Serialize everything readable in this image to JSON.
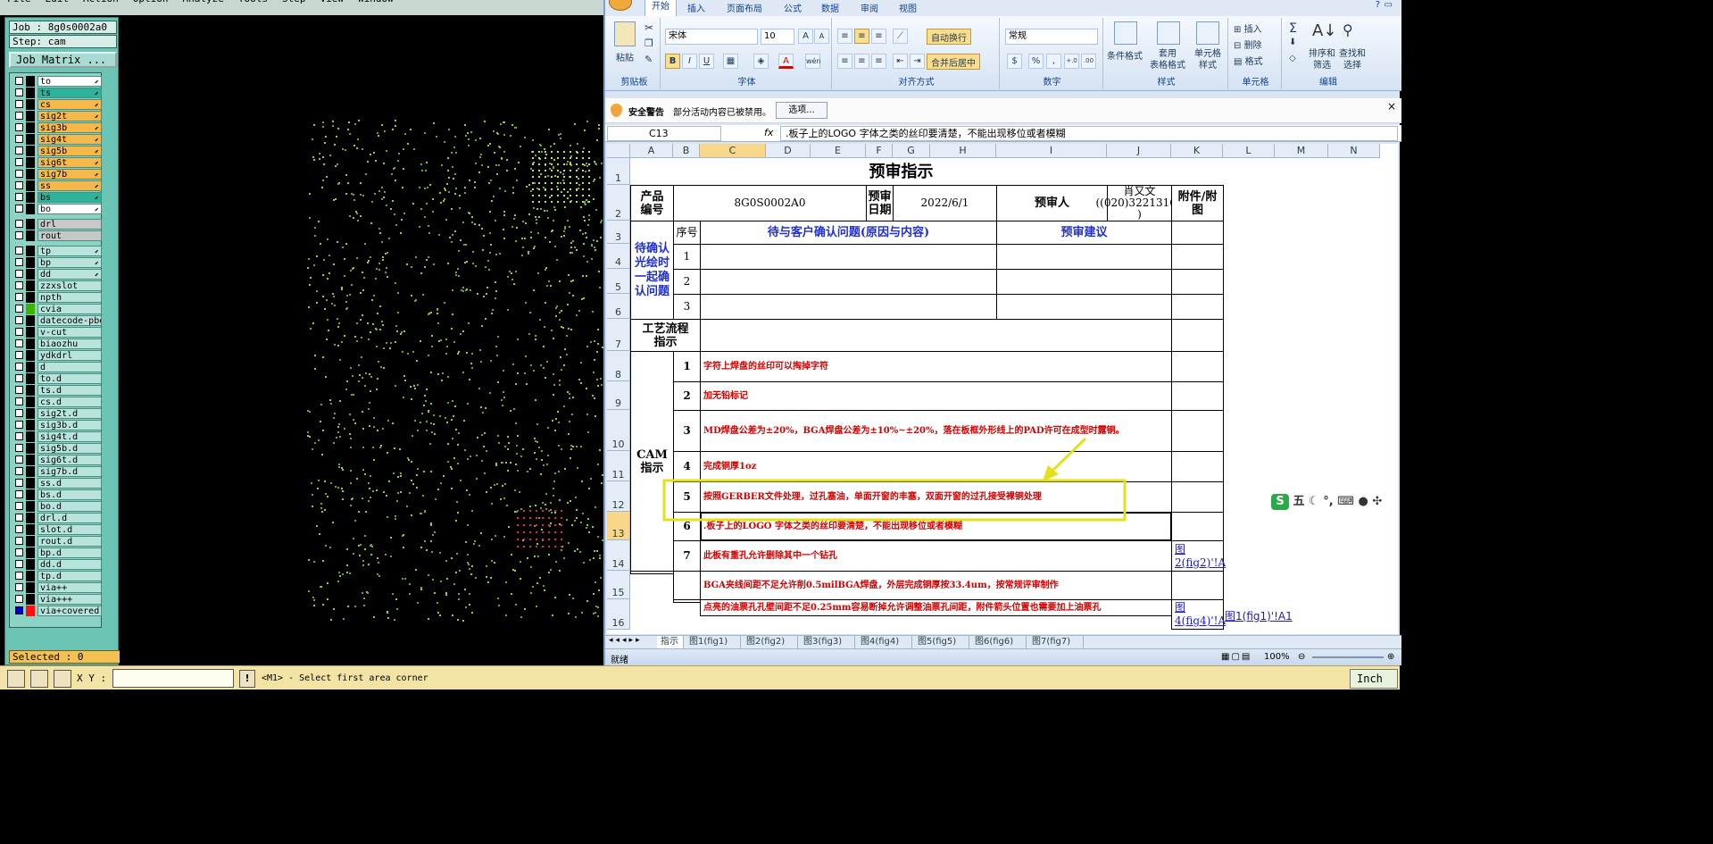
{
  "cam": {
    "menu": [
      "File",
      "Edit",
      "Action",
      "Option",
      "Analyze",
      "Tools",
      "Step",
      "View",
      "Window"
    ],
    "job_label": "Job : 8g0s0002a0",
    "step_label": "Step: cam",
    "job_matrix_button": "Job Matrix ...",
    "layers": [
      {
        "name": "to",
        "color": "#ffffff",
        "arrow": true,
        "checked": false
      },
      {
        "name": "ts",
        "color": "#2db39a",
        "arrow": true,
        "checked": false
      },
      {
        "name": "cs",
        "color": "#f7b84a",
        "arrow": true,
        "checked": false
      },
      {
        "name": "sig2t",
        "color": "#f7b84a",
        "arrow": true,
        "checked": false
      },
      {
        "name": "sig3b",
        "color": "#f7b84a",
        "arrow": true,
        "checked": false
      },
      {
        "name": "sig4t",
        "color": "#f7b84a",
        "arrow": true,
        "checked": false
      },
      {
        "name": "sig5b",
        "color": "#f7b84a",
        "arrow": true,
        "checked": false
      },
      {
        "name": "sig6t",
        "color": "#f7b84a",
        "arrow": true,
        "checked": false
      },
      {
        "name": "sig7b",
        "color": "#f7b84a",
        "arrow": true,
        "checked": false
      },
      {
        "name": "ss",
        "color": "#f7b84a",
        "arrow": true,
        "checked": false
      },
      {
        "name": "bs",
        "color": "#2db39a",
        "arrow": true,
        "checked": false
      },
      {
        "name": "bo",
        "color": "#ffffff",
        "arrow": true,
        "checked": false
      },
      {
        "name": "drl",
        "color": "#c8c8c8",
        "arrow": false,
        "checked": false
      },
      {
        "name": "rout",
        "color": "#c8c8c8",
        "arrow": false,
        "checked": false
      },
      {
        "name": "tp",
        "color": "#b8e4dc",
        "arrow": true,
        "checked": false
      },
      {
        "name": "bp",
        "color": "#b8e4dc",
        "arrow": true,
        "checked": false
      },
      {
        "name": "dd",
        "color": "#b8e4dc",
        "arrow": true,
        "checked": false
      },
      {
        "name": "zzxslot",
        "color": "#b8e4dc",
        "arrow": false,
        "checked": false
      },
      {
        "name": "npth",
        "color": "#b8e4dc",
        "arrow": false,
        "checked": false
      },
      {
        "name": "cvia",
        "color": "#b8e4dc",
        "arrow": false,
        "checked": false
      },
      {
        "name": "datecode-pbe",
        "color": "#b8e4dc",
        "arrow": false,
        "checked": false
      },
      {
        "name": "v-cut",
        "color": "#b8e4dc",
        "arrow": false,
        "checked": false
      },
      {
        "name": "biaozhu",
        "color": "#b8e4dc",
        "arrow": false,
        "checked": false
      },
      {
        "name": "ydkdrl",
        "color": "#b8e4dc",
        "arrow": false,
        "checked": false
      },
      {
        "name": "d",
        "color": "#b8e4dc",
        "arrow": false,
        "checked": false
      },
      {
        "name": "to.d",
        "color": "#b8e4dc",
        "arrow": false,
        "checked": false
      },
      {
        "name": "ts.d",
        "color": "#b8e4dc",
        "arrow": false,
        "checked": false
      },
      {
        "name": "cs.d",
        "color": "#b8e4dc",
        "arrow": false,
        "checked": false
      },
      {
        "name": "sig2t.d",
        "color": "#b8e4dc",
        "arrow": false,
        "checked": false
      },
      {
        "name": "sig3b.d",
        "color": "#b8e4dc",
        "arrow": false,
        "checked": false
      },
      {
        "name": "sig4t.d",
        "color": "#b8e4dc",
        "arrow": false,
        "checked": false
      },
      {
        "name": "sig5b.d",
        "color": "#b8e4dc",
        "arrow": false,
        "checked": false
      },
      {
        "name": "sig6t.d",
        "color": "#b8e4dc",
        "arrow": false,
        "checked": false
      },
      {
        "name": "sig7b.d",
        "color": "#b8e4dc",
        "arrow": false,
        "checked": false
      },
      {
        "name": "ss.d",
        "color": "#b8e4dc",
        "arrow": false,
        "checked": false
      },
      {
        "name": "bs.d",
        "color": "#b8e4dc",
        "arrow": false,
        "checked": false
      },
      {
        "name": "bo.d",
        "color": "#b8e4dc",
        "arrow": false,
        "checked": false
      },
      {
        "name": "drl.d",
        "color": "#b8e4dc",
        "arrow": false,
        "checked": false
      },
      {
        "name": "slot.d",
        "color": "#b8e4dc",
        "arrow": false,
        "checked": false
      },
      {
        "name": "rout.d",
        "color": "#b8e4dc",
        "arrow": false,
        "checked": false
      },
      {
        "name": "bp.d",
        "color": "#b8e4dc",
        "arrow": false,
        "checked": false
      },
      {
        "name": "dd.d",
        "color": "#b8e4dc",
        "arrow": false,
        "checked": false
      },
      {
        "name": "tp.d",
        "color": "#b8e4dc",
        "arrow": false,
        "checked": false
      },
      {
        "name": "via++",
        "color": "#b8e4dc",
        "arrow": false,
        "checked": false
      },
      {
        "name": "via+++",
        "color": "#b8e4dc",
        "arrow": false,
        "checked": false
      },
      {
        "name": "via+covered",
        "color": "#b8e4dc",
        "arrow": false,
        "checked": true
      }
    ],
    "selected_label": "Selected : 0",
    "xy_label": "X Y :",
    "status_message": "<M1> - Select first area corner",
    "units": "Inch"
  },
  "excel": {
    "ribbon_tabs": [
      "开始",
      "插入",
      "页面布局",
      "公式",
      "数据",
      "审阅",
      "视图"
    ],
    "clipboard": {
      "paste": "粘贴",
      "label": "剪贴板"
    },
    "font": {
      "name": "宋体",
      "size": "10",
      "label": "字体"
    },
    "alignment": {
      "wrap": "自动换行",
      "merge": "合并后居中",
      "label": "对齐方式"
    },
    "number": {
      "format": "常规",
      "label": "数字"
    },
    "styles": {
      "cond": "条件格式",
      "table": "套用\n表格格式",
      "cell": "单元格\n样式",
      "label": "样式"
    },
    "cells": {
      "insert": "插入",
      "delete": "删除",
      "format": "格式",
      "label": "单元格"
    },
    "editing": {
      "sort": "排序和\n筛选",
      "find": "查找和\n选择",
      "label": "编辑"
    },
    "security": {
      "title": "安全警告",
      "message": "部分活动内容已被禁用。",
      "button": "选项..."
    },
    "name_box": "C13",
    "fx": "fx",
    "formula": ".板子上的LOGO 字体之类的丝印要清楚，不能出现移位或者模糊",
    "columns": [
      "A",
      "B",
      "C",
      "D",
      "E",
      "F",
      "G",
      "H",
      "I",
      "J",
      "K",
      "L",
      "M",
      "N"
    ],
    "rows": [
      "1",
      "2",
      "3",
      "4",
      "5",
      "6",
      "7",
      "8",
      "9",
      "10",
      "11",
      "12",
      "13",
      "14",
      "15",
      "16"
    ],
    "sheet": {
      "title": "预审指示",
      "product_no_label": "产品\n编号",
      "product_no": "8G0S0002A0",
      "review_date_label": "预审日期",
      "review_date": "2022/6/1",
      "reviewer_label": "预审人",
      "reviewer": "肖又文\n((020)32213167\n)",
      "attachment_label": "附件/附图",
      "seq_label": "序号",
      "issue_header": "待与客户确认问题(原因与内容)",
      "advice_header": "预审建议",
      "pending_label": "待确认光绘时一起确认问题",
      "pending_nums": [
        "1",
        "2",
        "3"
      ],
      "process_label": "工艺流程\n指示",
      "cam_label": "CAM\n指示",
      "cam_items": [
        {
          "n": "1",
          "text": "字符上焊盘的丝印可以掏掉字符",
          "link": ""
        },
        {
          "n": "2",
          "text": "加无铅标记",
          "link": ""
        },
        {
          "n": "3",
          "text": "MD焊盘公差为±20%，BGA焊盘公差为±10%~±20%，落在板框外形线上的PAD许可在成型时露铜。",
          "link": ""
        },
        {
          "n": "4",
          "text": "完成铜厚1oz",
          "link": ""
        },
        {
          "n": "5",
          "text": "按照GERBER文件处理，过孔塞油，单面开窗的丰塞，双面开窗的过孔接受裸铜处理",
          "link": ""
        },
        {
          "n": "6",
          "text": ".板子上的LOGO 字体之类的丝印要清楚，不能出现移位或者模糊",
          "link": ""
        },
        {
          "n": "7",
          "text": "此板有重孔允许删除其中一个钻孔",
          "link": "图2(fig2)'!A"
        },
        {
          "n": "",
          "text": "BGA夹线间距不足允许削0.5milBGA焊盘，外层完成铜厚按33.4um，按常规评审制作",
          "link": ""
        },
        {
          "n": "",
          "text": "点亮的油票孔孔壁间距不足0.25mm容易断掉允许调整油票孔间距，附件箭头位置也需要加上油票孔",
          "link": "图4(fig4)'!A"
        }
      ],
      "outside_link": "图1(fig1)'!A1"
    },
    "sheet_tabs": [
      "指示",
      "图1(fig1)",
      "图2(fig2)",
      "图3(fig3)",
      "图4(fig4)",
      "图5(fig5)",
      "图6(fig6)",
      "图7(fig7)"
    ],
    "status": {
      "ready": "就绪",
      "zoom": "100%"
    },
    "ime_text": "五"
  }
}
